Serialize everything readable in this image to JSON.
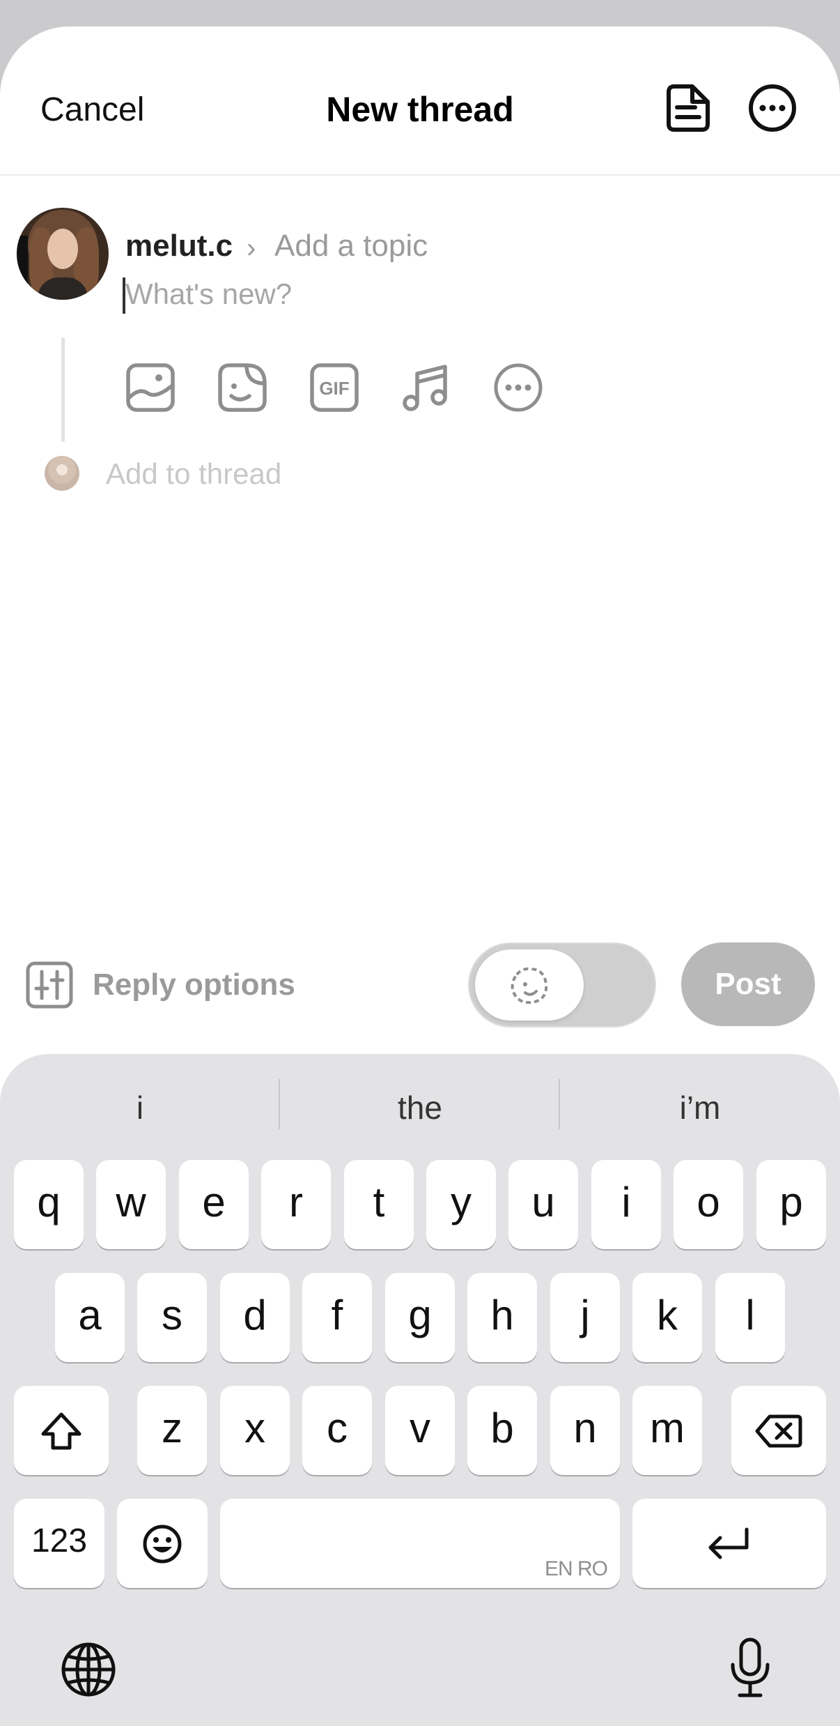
{
  "header": {
    "cancel_label": "Cancel",
    "title": "New thread",
    "drafts_icon": "drafts-document-icon",
    "more_icon": "more-options-icon"
  },
  "composer": {
    "username": "melut.c",
    "topic_placeholder": "Add a topic",
    "text_placeholder": "What's new?",
    "add_to_thread_label": "Add to thread",
    "attachment_tools": [
      "image-icon",
      "sticker-icon",
      "gif-icon",
      "music-icon",
      "more-icon"
    ],
    "gif_text": "GIF"
  },
  "footer": {
    "reply_options_label": "Reply options",
    "post_label": "Post"
  },
  "keyboard": {
    "suggestions": [
      "i",
      "the",
      "i’m"
    ],
    "row1": [
      "q",
      "w",
      "e",
      "r",
      "t",
      "y",
      "u",
      "i",
      "o",
      "p"
    ],
    "row2": [
      "a",
      "s",
      "d",
      "f",
      "g",
      "h",
      "j",
      "k",
      "l"
    ],
    "row3": [
      "z",
      "x",
      "c",
      "v",
      "b",
      "n",
      "m"
    ],
    "numbers_label": "123",
    "space_languages": "EN RO"
  },
  "colors": {
    "background": "#ffffff",
    "post_button_disabled": "#b8b8b8",
    "keyboard_bg": "#e3e3e6",
    "placeholder": "#a6a6a6"
  }
}
